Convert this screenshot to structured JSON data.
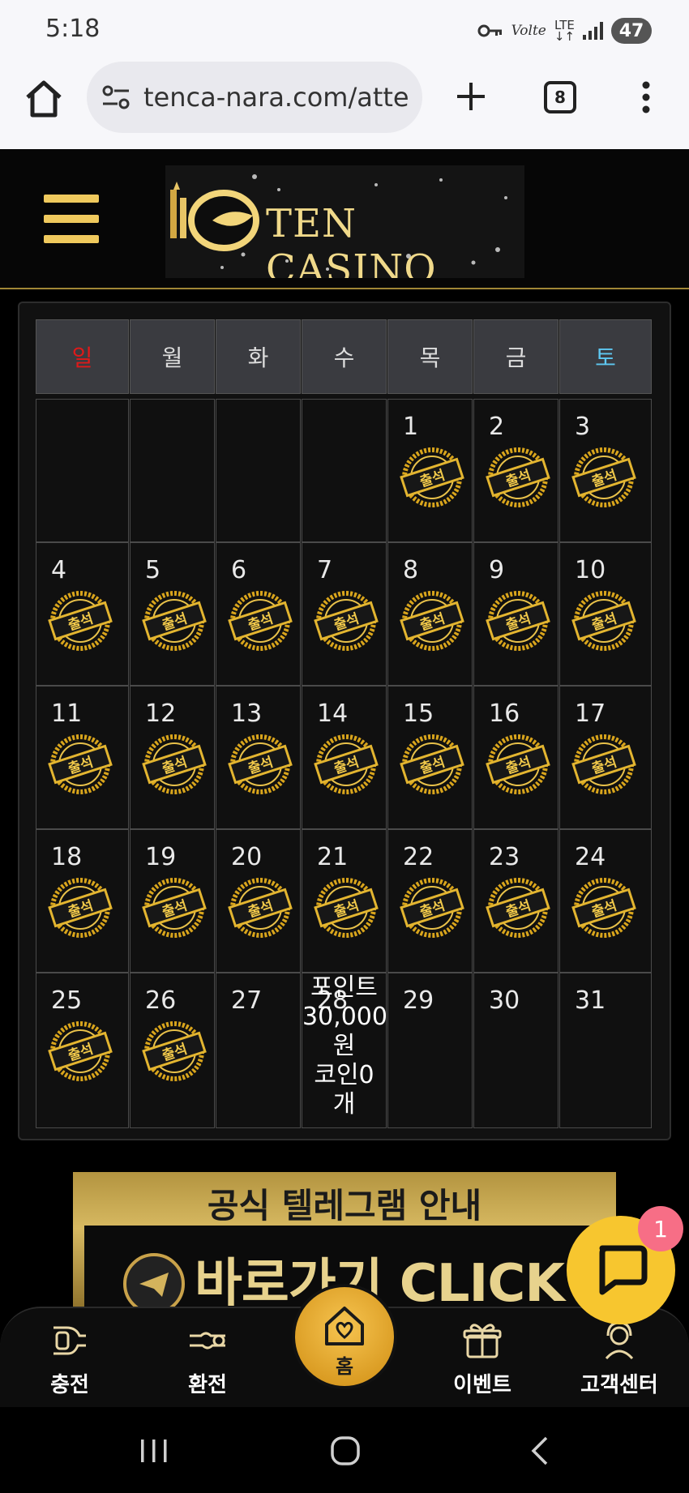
{
  "status_bar": {
    "time": "5:18",
    "volte": "Volte",
    "lte": "LTE",
    "battery": "47"
  },
  "browser": {
    "url": "tenca-nara.com/atte",
    "tab_count": "8",
    "icons": [
      "home-icon",
      "tune-icon",
      "plus-icon",
      "tabs-icon",
      "more-vert-icon"
    ]
  },
  "site": {
    "logo_text": "TEN CASINO",
    "colors": {
      "gold": "#efc95d",
      "sunday": "#e01919",
      "saturday": "#5ec8f2"
    }
  },
  "calendar": {
    "weekdays": [
      "일",
      "월",
      "화",
      "수",
      "목",
      "금",
      "토"
    ],
    "stamp_label": "출석",
    "weeks": [
      [
        {
          "day": "",
          "stamp": false
        },
        {
          "day": "",
          "stamp": false
        },
        {
          "day": "",
          "stamp": false
        },
        {
          "day": "",
          "stamp": false
        },
        {
          "day": "1",
          "stamp": true
        },
        {
          "day": "2",
          "stamp": true
        },
        {
          "day": "3",
          "stamp": true
        }
      ],
      [
        {
          "day": "4",
          "stamp": true
        },
        {
          "day": "5",
          "stamp": true
        },
        {
          "day": "6",
          "stamp": true
        },
        {
          "day": "7",
          "stamp": true
        },
        {
          "day": "8",
          "stamp": true
        },
        {
          "day": "9",
          "stamp": true
        },
        {
          "day": "10",
          "stamp": true
        }
      ],
      [
        {
          "day": "11",
          "stamp": true
        },
        {
          "day": "12",
          "stamp": true
        },
        {
          "day": "13",
          "stamp": true
        },
        {
          "day": "14",
          "stamp": true
        },
        {
          "day": "15",
          "stamp": true
        },
        {
          "day": "16",
          "stamp": true
        },
        {
          "day": "17",
          "stamp": true
        }
      ],
      [
        {
          "day": "18",
          "stamp": true
        },
        {
          "day": "19",
          "stamp": true
        },
        {
          "day": "20",
          "stamp": true
        },
        {
          "day": "21",
          "stamp": true
        },
        {
          "day": "22",
          "stamp": true
        },
        {
          "day": "23",
          "stamp": true
        },
        {
          "day": "24",
          "stamp": true
        }
      ],
      [
        {
          "day": "25",
          "stamp": true
        },
        {
          "day": "26",
          "stamp": true
        },
        {
          "day": "27",
          "stamp": false
        },
        {
          "day": "28",
          "stamp": false,
          "reward": [
            "포인트",
            "30,000",
            "원",
            "코인0",
            "개"
          ]
        },
        {
          "day": "29",
          "stamp": false
        },
        {
          "day": "30",
          "stamp": false
        },
        {
          "day": "31",
          "stamp": false
        }
      ]
    ]
  },
  "banner": {
    "title": "공식 텔레그램 안내",
    "cta": "바로가기 CLICK"
  },
  "chat": {
    "badge": "1"
  },
  "bottom_nav": {
    "items": [
      {
        "label": "충전",
        "icon": "charge-icon"
      },
      {
        "label": "환전",
        "icon": "exchange-icon"
      },
      {
        "label": "홈",
        "icon": "home-heart-icon"
      },
      {
        "label": "이벤트",
        "icon": "gift-icon"
      },
      {
        "label": "고객센터",
        "icon": "support-agent-icon"
      }
    ]
  }
}
